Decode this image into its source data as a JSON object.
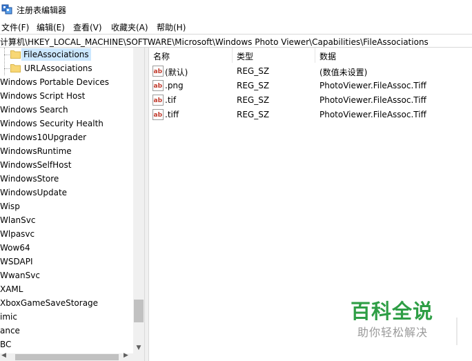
{
  "window": {
    "title": "注册表编辑器"
  },
  "menu": [
    {
      "label": "文件(F)"
    },
    {
      "label": "编辑(E)"
    },
    {
      "label": "查看(V)"
    },
    {
      "label": "收藏夹(A)"
    },
    {
      "label": "帮助(H)"
    }
  ],
  "address": {
    "path": "计算机\\HKEY_LOCAL_MACHINE\\SOFTWARE\\Microsoft\\Windows Photo Viewer\\Capabilities\\FileAssociations"
  },
  "tree": {
    "items": [
      {
        "label": "FileAssociations",
        "selected": true,
        "folder": true
      },
      {
        "label": "URLAssociations",
        "selected": false,
        "folder": true
      },
      {
        "label": "Windows Portable Devices"
      },
      {
        "label": "Windows Script Host"
      },
      {
        "label": "Windows Search"
      },
      {
        "label": "Windows Security Health"
      },
      {
        "label": "Windows10Upgrader"
      },
      {
        "label": "WindowsRuntime"
      },
      {
        "label": "WindowsSelfHost"
      },
      {
        "label": "WindowsStore"
      },
      {
        "label": "WindowsUpdate"
      },
      {
        "label": "Wisp"
      },
      {
        "label": "WlanSvc"
      },
      {
        "label": "Wlpasvc"
      },
      {
        "label": "Wow64"
      },
      {
        "label": "WSDAPI"
      },
      {
        "label": "WwanSvc"
      },
      {
        "label": "XAML"
      },
      {
        "label": "XboxGameSaveStorage"
      },
      {
        "label": "imic"
      },
      {
        "label": "ance"
      },
      {
        "label": "BC"
      }
    ]
  },
  "list": {
    "columns": [
      "名称",
      "类型",
      "数据"
    ],
    "rows": [
      {
        "name": "(默认)",
        "type": "REG_SZ",
        "data": "(数值未设置)"
      },
      {
        "name": ".png",
        "type": "REG_SZ",
        "data": "PhotoViewer.FileAssoc.Tiff"
      },
      {
        "name": ".tif",
        "type": "REG_SZ",
        "data": "PhotoViewer.FileAssoc.Tiff"
      },
      {
        "name": ".tiff",
        "type": "REG_SZ",
        "data": "PhotoViewer.FileAssoc.Tiff"
      }
    ]
  },
  "watermark": {
    "title": "百科全说",
    "subtitle": "助你轻松解决"
  },
  "colors": {
    "selection": "#cce8ff",
    "folder": "#f8d775",
    "watermark_green": "#2e9e45",
    "ab_red": "#c0392b"
  },
  "icons": {
    "app": "regedit-icon",
    "folder": "folder-icon",
    "value": "string-value-icon"
  }
}
